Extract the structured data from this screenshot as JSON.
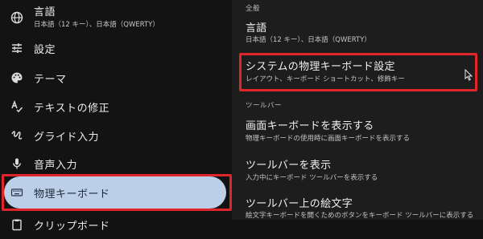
{
  "sidebar": {
    "items": [
      {
        "label": "言語",
        "sub": "日本語（12 キー）、日本語（QWERTY）",
        "icon": "globe-icon"
      },
      {
        "label": "設定",
        "icon": "tune-icon"
      },
      {
        "label": "テーマ",
        "icon": "palette-icon"
      },
      {
        "label": "テキストの修正",
        "icon": "spellcheck-icon"
      },
      {
        "label": "グライド入力",
        "icon": "gesture-icon"
      },
      {
        "label": "音声入力",
        "icon": "mic-icon"
      },
      {
        "label": "物理キーボード",
        "icon": "keyboard-icon",
        "selected": true
      },
      {
        "label": "クリップボード",
        "icon": "clipboard-icon"
      }
    ]
  },
  "main": {
    "section_general": "全般",
    "language_title": "言語",
    "language_sub": "日本語（12 キー）、日本語（QWERTY）",
    "physical_title": "システムの物理キーボード設定",
    "physical_sub": "レイアウト、キーボード ショートカット、修飾キー",
    "section_toolbar": "ツールバー",
    "show_onscreen_title": "画面キーボードを表示する",
    "show_onscreen_sub": "物理キーボードの使用時に画面キーボードを表示する",
    "show_toolbar_title": "ツールバーを表示",
    "show_toolbar_sub": "入力中にキーボード ツールバーを表示する",
    "emoji_toolbar_title": "ツールバー上の絵文字",
    "emoji_toolbar_sub": "絵文字キーボードを開くためのボタンをキーボード ツールバーに表示する"
  },
  "colors": {
    "highlight": "#e0262b",
    "selected_bg": "#bccfe8"
  }
}
